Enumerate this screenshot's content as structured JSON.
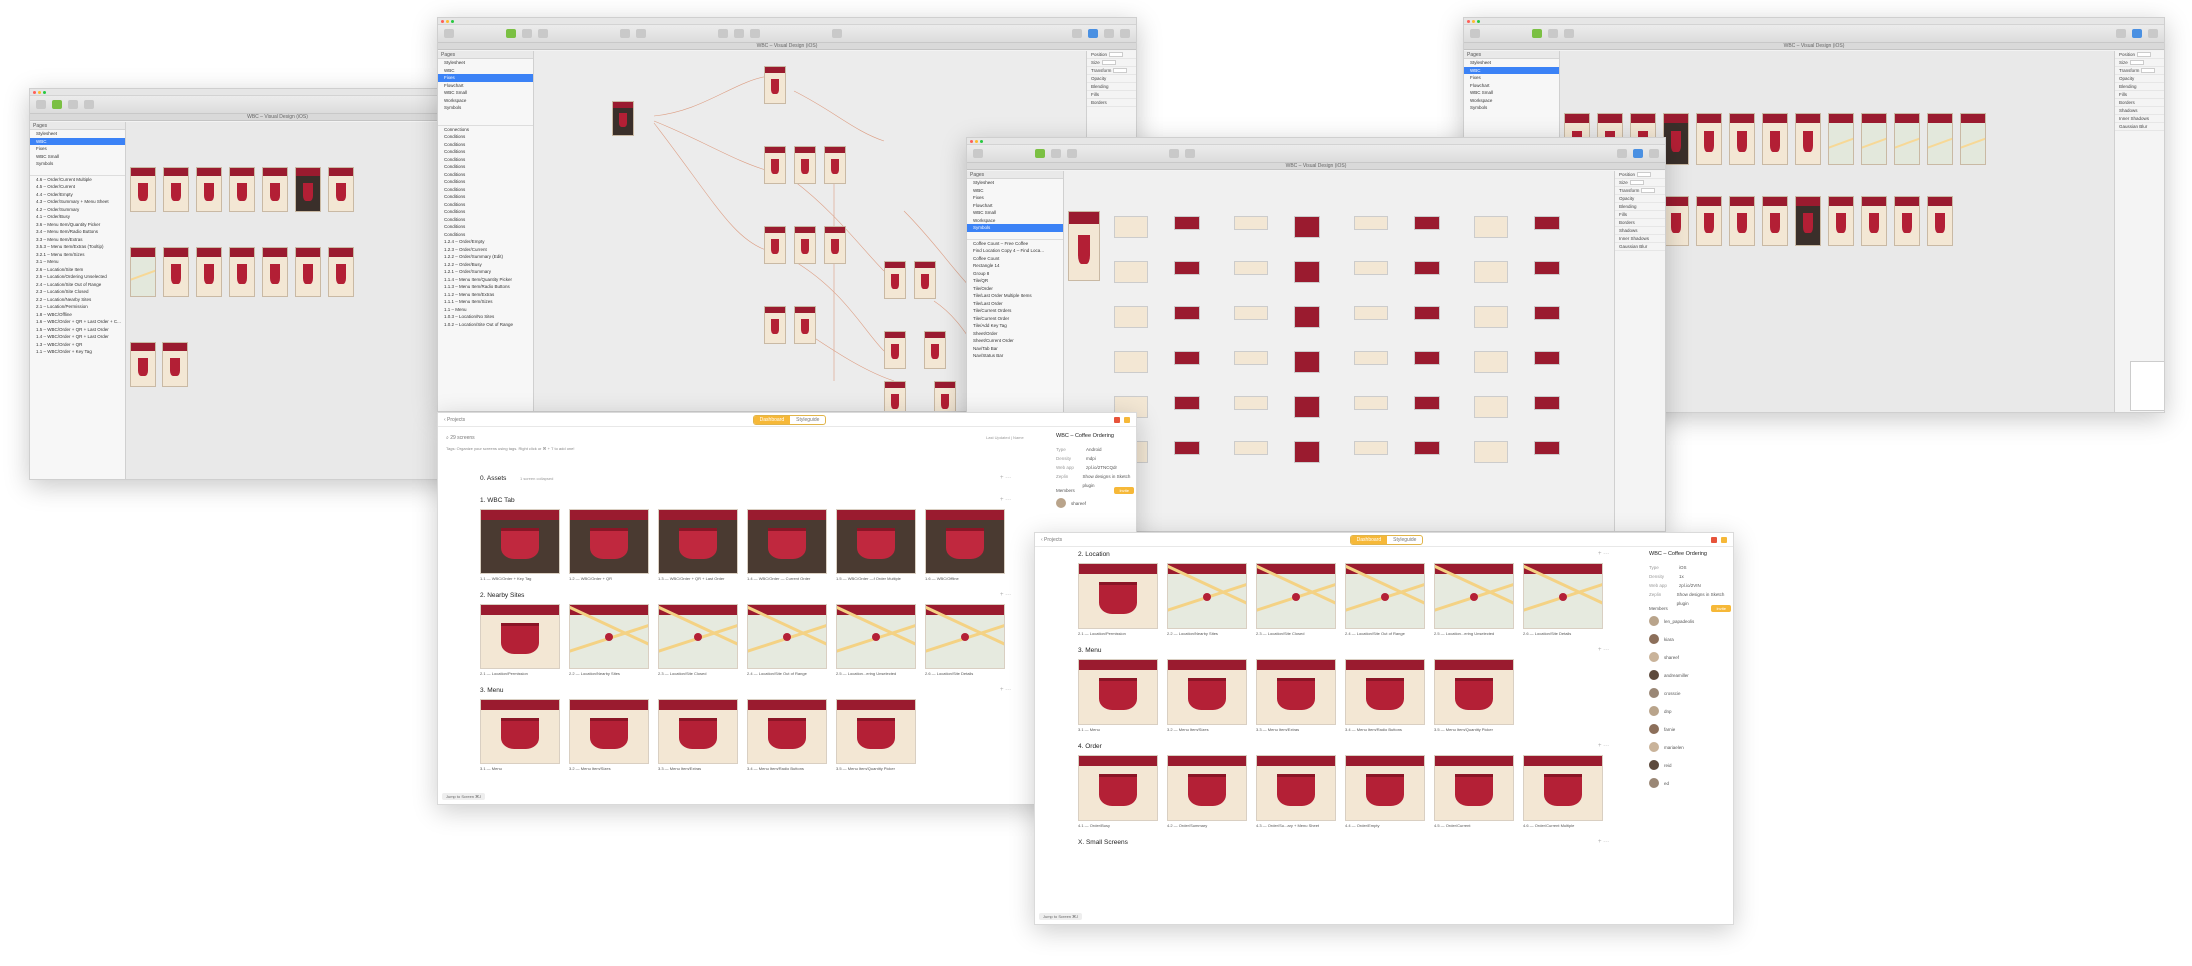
{
  "sketch_left": {
    "pages_header": "Pages",
    "pages": [
      "Stylesheet",
      "WBC",
      "Fixes",
      "WBC Small",
      "Symbols"
    ],
    "selected_page": 1,
    "layers": [
      "4.6 – Order/Current Multiple",
      "4.5 – Order/Current",
      "4.4 – Order/Empty",
      "4.3 – Order/Summary + Menu Sheet",
      "4.2 – Order/Summary",
      "4.1 – Order/Busy",
      "3.6 – Menu Item/Quantity Picker",
      "3.4 – Menu Item/Radio Buttons",
      "3.3 – Menu Item/Extras",
      "3.5.3 – Menu Item/Extras (Tooltip)",
      "3.2.1 – Menu Item/Sizes",
      "3.1 – Menu",
      "2.6 – Location/Site Item",
      "2.5 – Location/Ordering Unselected",
      "2.4 – Location/Site Out of Range",
      "2.3 – Location/Site Closed",
      "2.2 – Location/Nearby Sites",
      "2.1 – Location/Permission",
      "1.8 – WBC/Offline",
      "1.6 – WBC/Order + QR + Last Order + C...",
      "1.5 – WBC/Order + QR + Last Order",
      "1.4 – WBC/Order + QR + Last Order",
      "1.3 – WBC/Order + QR",
      "1.1 – WBC/Order + Key Tag"
    ]
  },
  "sketch_center": {
    "doc_title": "WBC – Visual Design (iOS)",
    "pages_header": "Pages",
    "pages": [
      "Stylesheet",
      "WBC",
      "Fixes",
      "Flowchart",
      "WBC Small",
      "Workspace",
      "Symbols"
    ],
    "selected_page": 2,
    "layers": [
      "Connections",
      "Conditions",
      "Conditions",
      "Conditions",
      "Conditions",
      "Conditions",
      "Conditions",
      "Conditions",
      "Conditions",
      "Conditions",
      "Conditions",
      "Conditions",
      "Conditions",
      "Conditions",
      "Conditions",
      "1.2.4 – Order/Empty",
      "1.2.3 – Order/Current",
      "1.2.2 – Order/Summary (Edit)",
      "1.2.2 – Order/Busy",
      "1.2.1 – Order/Summary",
      "1.1.4 – Menu Item/Quantity Picker",
      "1.1.3 – Menu Item/Radio Buttons",
      "1.1.2 – Menu Item/Extras",
      "1.1.1 – Menu Item/Sizes",
      "1.1 – Menu",
      "1.0.3 – Location/No Sites",
      "1.0.2 – Location/Site Out of Range"
    ],
    "inspector": [
      "Position",
      "Size",
      "Transform",
      "Opacity",
      "Blending",
      "Fills",
      "Borders"
    ]
  },
  "sketch_right": {
    "doc_title": "WBC – Visual Design (iOS)",
    "pages": [
      "Stylesheet",
      "WBC",
      "Fixes",
      "Flowchart",
      "WBC Small",
      "Workspace",
      "Symbols"
    ],
    "selected_page": 1,
    "inspector": [
      "Position",
      "Size",
      "Transform",
      "Opacity",
      "Blending",
      "Fills",
      "Borders",
      "Shadows",
      "Inner Shadows",
      "Gaussian Blur"
    ]
  },
  "sketch_symbols": {
    "doc_title": "WBC – Visual Design (iOS)",
    "pages": [
      "Stylesheet",
      "WBC",
      "Fixes",
      "Flowchart",
      "WBC Small",
      "Workspace",
      "Symbols"
    ],
    "selected_page": 6,
    "layers": [
      "Coffee Count – Free Coffee",
      "Find Location Copy 4 – Find Loca...",
      "Coffee Count",
      "Rectangle 14",
      "Group 8",
      "Tile/QR",
      "Tile/Order",
      "Tile/Last Order Multiple Items",
      "Tile/Last Order",
      "Tile/Current Orders",
      "Tile/Current Order",
      "Tile/Add Key Tag",
      "Sheet/Order",
      "Sheet/Current Order",
      "Nav/Tab Bar",
      "Nav/Status Bar"
    ],
    "inspector": [
      "Position",
      "Size",
      "Transform",
      "Opacity",
      "Blending",
      "Fills",
      "Borders",
      "Shadows",
      "Inner Shadows",
      "Gaussian Blur"
    ]
  },
  "zeplin_left": {
    "back": "‹ Projects",
    "tab_dashboard": "Dashboard",
    "tab_styleguide": "Styleguide",
    "screens_count": "29 screens",
    "tags_hint": "Tags: Organize your screens using tags. Right click or ⌘ + T to add one!",
    "last_updated": "Last Updated  |  Name",
    "sections": [
      {
        "title": "0. Assets",
        "sub": "1 screen collapsed",
        "screens": []
      },
      {
        "title": "1. WBC Tab",
        "screens": [
          "1.1 — WBC/Order + Key Tag",
          "1.2 — WBC/Order + QR",
          "1.3 — WBC/Order + QR + Last Order",
          "1.4 — WBC/Order — Current Order",
          "1.5 — WBC/Order —f Order Multiple",
          "1.6 — WBC/Offline"
        ]
      },
      {
        "title": "2. Nearby Sites",
        "screens": [
          "2.1 — Location/Permission",
          "2.2 — Location/Nearby Sites",
          "2.3 — Location/Site Closed",
          "2.4 — Location/Site Out of Range",
          "2.5 — Location...ering Unselected",
          "2.6 — Location/Site Details"
        ]
      },
      {
        "title": "3. Menu",
        "screens": [
          "3.1 — Menu",
          "3.2 — Menu Item/Sizes",
          "3.3 — Menu Item/Extras",
          "3.4 — Menu Item/Radio Buttons",
          "3.5 — Menu Item/Quantity Picker"
        ]
      }
    ],
    "project_name": "WBC – Coffee Ordering",
    "info": [
      [
        "Type",
        "Android"
      ],
      [
        "Density",
        "mdpi"
      ],
      [
        "Web app",
        "zpl.io/2TNCQdr"
      ],
      [
        "Zeplin",
        "Show designs in Sketch plugin"
      ]
    ],
    "members_label": "Members",
    "invite": "Invite",
    "members": [
      "shareef"
    ],
    "jump": "Jump to Screen  ⌘J"
  },
  "zeplin_right": {
    "back": "‹ Projects",
    "tab_dashboard": "Dashboard",
    "tab_styleguide": "Styleguide",
    "sections": [
      {
        "title": "2. Location",
        "screens": [
          "2.1 — Location/Permission",
          "2.2 — Location/Nearby Sites",
          "2.3 — Location/Site Closed",
          "2.4 — Location/Site Out of Range",
          "2.5 — Location...ering Unselected",
          "2.6 — Location/Site Details"
        ]
      },
      {
        "title": "3. Menu",
        "screens": [
          "3.1 — Menu",
          "3.2 — Menu Item/Sizes",
          "3.3 — Menu Item/Extras",
          "3.4 — Menu Item/Radio Buttons",
          "3.5 — Menu Item/Quantity Picker"
        ]
      },
      {
        "title": "4. Order",
        "screens": [
          "4.1 — Order/Busy",
          "4.2 — Order/Summary",
          "4.3 — Order/Su...ary + Menu Sheet",
          "4.4 — Order/Empty",
          "4.5 — Order/Current",
          "4.6 — Order/Current Multiple"
        ]
      },
      {
        "title": "X. Small Screens",
        "screens": []
      }
    ],
    "project_name": "WBC – Coffee Ordering",
    "info": [
      [
        "Type",
        "iOS"
      ],
      [
        "Density",
        "1x"
      ],
      [
        "Web app",
        "zpl.io/2VIN"
      ],
      [
        "Zeplin",
        "Show designs in Sketch plugin"
      ]
    ],
    "members_label": "Members",
    "invite": "Invite",
    "members": [
      "len_papadeolis",
      "kiara",
      "shareef",
      "andreamiller",
      "crosscie",
      "dnp",
      "farnie",
      "mariaelen",
      "reid",
      "ed"
    ],
    "jump": "Jump to Screen  ⌘J"
  },
  "colors": {
    "brand_red": "#9a1b2f",
    "cream": "#f3e7d4",
    "accent_orange": "#f6b838",
    "selection_blue": "#3b82f6"
  }
}
